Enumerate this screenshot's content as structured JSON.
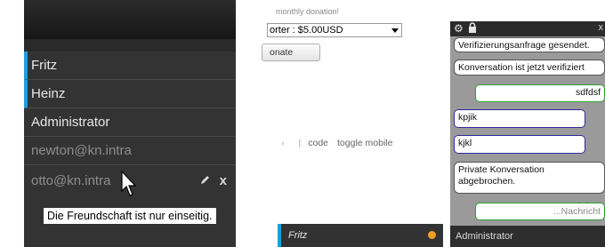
{
  "contacts": {
    "items": [
      {
        "label": "Fritz",
        "active": true
      },
      {
        "label": "Heinz",
        "active": true
      },
      {
        "label": "Administrator",
        "active": false
      },
      {
        "label": "newton@kn.intra",
        "active": false
      },
      {
        "label": "otto@kn.intra",
        "active": false
      }
    ],
    "tooltip": "Die Freundschaft ist nur einseitig."
  },
  "donation": {
    "text": "monthly donation!",
    "select_value": "orter : $5.00USD",
    "button_label": "onate"
  },
  "footer": {
    "separator_left": "›",
    "separator": "|",
    "code_link": "code",
    "toggle_link": "toggle mobile"
  },
  "bottombar": {
    "contact": "Fritz",
    "status_color": "#f0a020"
  },
  "chat": {
    "close": "x",
    "messages": [
      {
        "text": "Verifizierungsanfrage gesendet.",
        "kind": "sys"
      },
      {
        "text": "Konversation ist jetzt verifiziert",
        "kind": "sys"
      },
      {
        "text": "sdfdsf",
        "kind": "mine"
      },
      {
        "text": "kpjik",
        "kind": "peer"
      },
      {
        "text": "kjkl",
        "kind": "peer"
      },
      {
        "text": "Private Konversation abgebrochen.",
        "kind": "sys"
      }
    ],
    "input_placeholder": "...Nachricht",
    "footer_contact": "Administrator"
  },
  "icons": {
    "settings": "gear-icon",
    "lock": "lock-icon",
    "edit": "pencil-icon",
    "remove": "close-icon",
    "pointer": "mouse-cursor-icon"
  },
  "colors": {
    "accent": "#1e9de0",
    "panel": "#333333",
    "status_away": "#f0a020",
    "own_message_border": "#2fa02f",
    "peer_message_border": "#2d2d9a"
  }
}
